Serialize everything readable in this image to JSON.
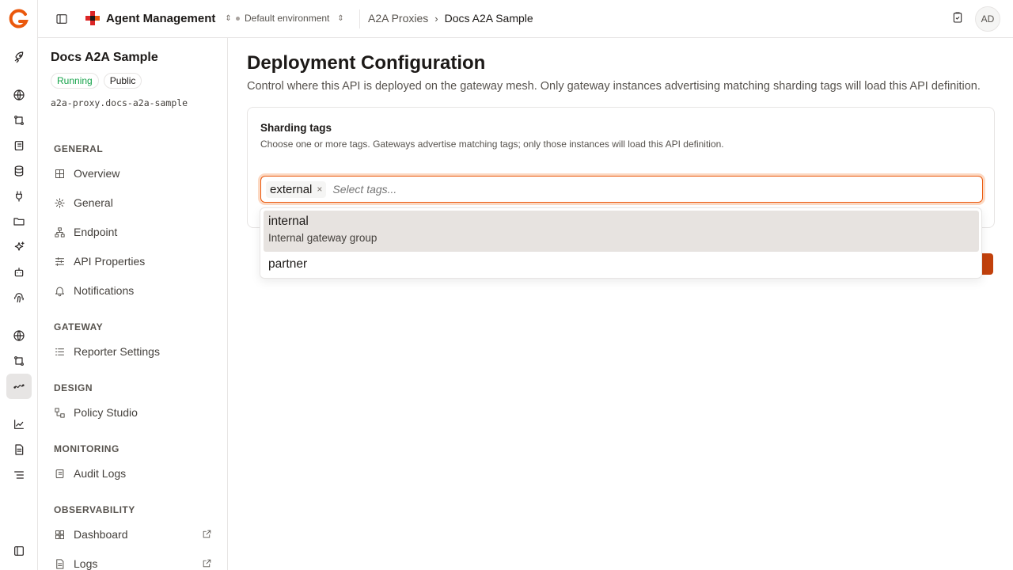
{
  "rail": {
    "icons": [
      "rocket-icon",
      "globe-icon",
      "api-icon",
      "scroll-icon",
      "database-icon",
      "plug-icon",
      "folder-icon",
      "sparkles-icon",
      "bot-icon",
      "fingerprint-icon",
      "globe-icon",
      "api-icon",
      "agent-proxy-icon",
      "chart-line-icon",
      "document-icon",
      "list-icon",
      "panel-icon"
    ],
    "active": "agent-proxy-icon"
  },
  "topbar": {
    "org_name": "Agent Management",
    "environment": "Default environment",
    "breadcrumb_parent": "A2A Proxies",
    "breadcrumb_current": "Docs A2A Sample",
    "avatar_initials": "AD"
  },
  "sidebar": {
    "api_name": "Docs A2A Sample",
    "status_badge": "Running",
    "visibility_badge": "Public",
    "api_path": "a2a-proxy.docs-a2a-sample",
    "sections": {
      "general": "GENERAL",
      "gateway": "GATEWAY",
      "design": "DESIGN",
      "monitoring": "MONITORING",
      "observability": "OBSERVABILITY"
    },
    "items": {
      "overview": "Overview",
      "general": "General",
      "endpoint": "Endpoint",
      "api_properties": "API Properties",
      "notifications": "Notifications",
      "reporter_settings": "Reporter Settings",
      "policy_studio": "Policy Studio",
      "audit_logs": "Audit Logs",
      "dashboard": "Dashboard",
      "logs": "Logs"
    }
  },
  "main": {
    "title": "Deployment Configuration",
    "description": "Control where this API is deployed on the gateway mesh. Only gateway instances advertising matching sharding tags will load this API definition.",
    "card": {
      "title": "Sharding tags",
      "description": "Choose one or more tags. Gateways advertise matching tags; only those instances will load this API definition.",
      "selected_tag": "external",
      "chip_remove": "×",
      "placeholder": "Select tags..."
    },
    "save_button_fragment": "s"
  },
  "dropdown": {
    "options": [
      {
        "label": "internal",
        "description": "Internal gateway group",
        "highlighted": true
      },
      {
        "label": "partner"
      }
    ]
  },
  "colors": {
    "accent": "#ea580c",
    "accent_dark": "#c2410c",
    "running": "#16a34a"
  }
}
